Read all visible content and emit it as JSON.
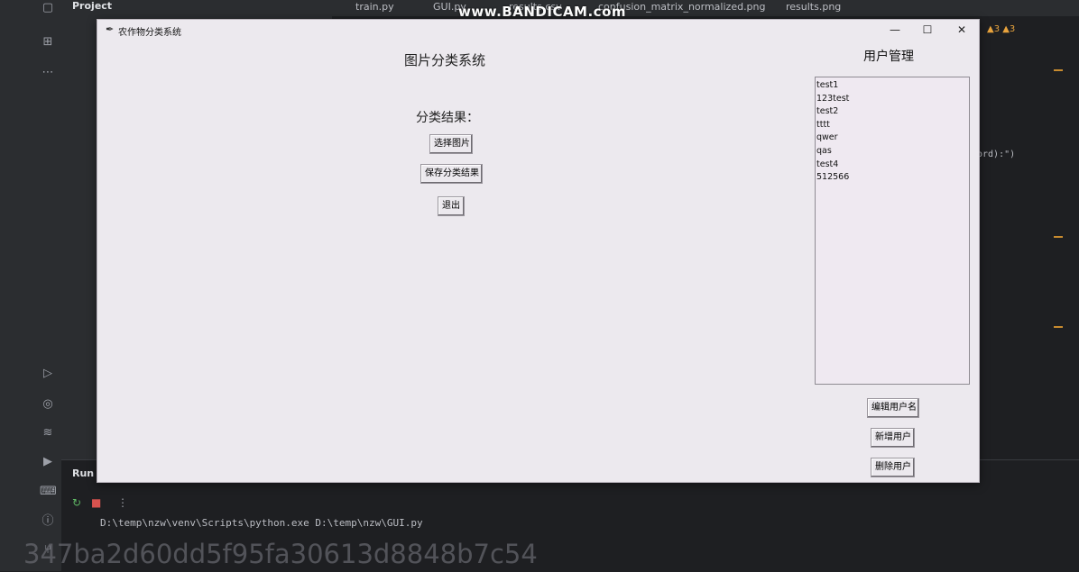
{
  "ide": {
    "project_label": "Project",
    "tabs": [
      "train.py",
      "GUI.py",
      "results.csv",
      "confusion_matrix_normalized.png",
      "results.png"
    ],
    "warnings": "▲3 ▲3",
    "code_fragment": "ord):\")",
    "run_label": "Run",
    "console_line": "D:\\temp\\nzw\\venv\\Scripts\\python.exe D:\\temp\\nzw\\GUI.py"
  },
  "watermark": {
    "top": "www.BANDICAM.com",
    "bottom": "347ba2d60dd5f95fa30613d8848b7c54"
  },
  "app": {
    "window_title": "农作物分类系统",
    "title": "图片分类系统",
    "result_label": "分类结果：",
    "buttons": {
      "select_image": "选择图片",
      "save_result": "保存分类结果",
      "exit": "退出",
      "edit_username": "编辑用户名",
      "add_user": "新增用户",
      "delete_user": "删除用户"
    },
    "user_panel_title": "用户管理",
    "users": [
      "test1",
      "123test",
      "test2",
      "tttt",
      "qwer",
      "qas",
      "test4",
      "512566"
    ]
  },
  "colors": {
    "window_bg": "#ece9ee",
    "listbox_bg": "#efe9f1",
    "ide_bg": "#1e1f22"
  }
}
